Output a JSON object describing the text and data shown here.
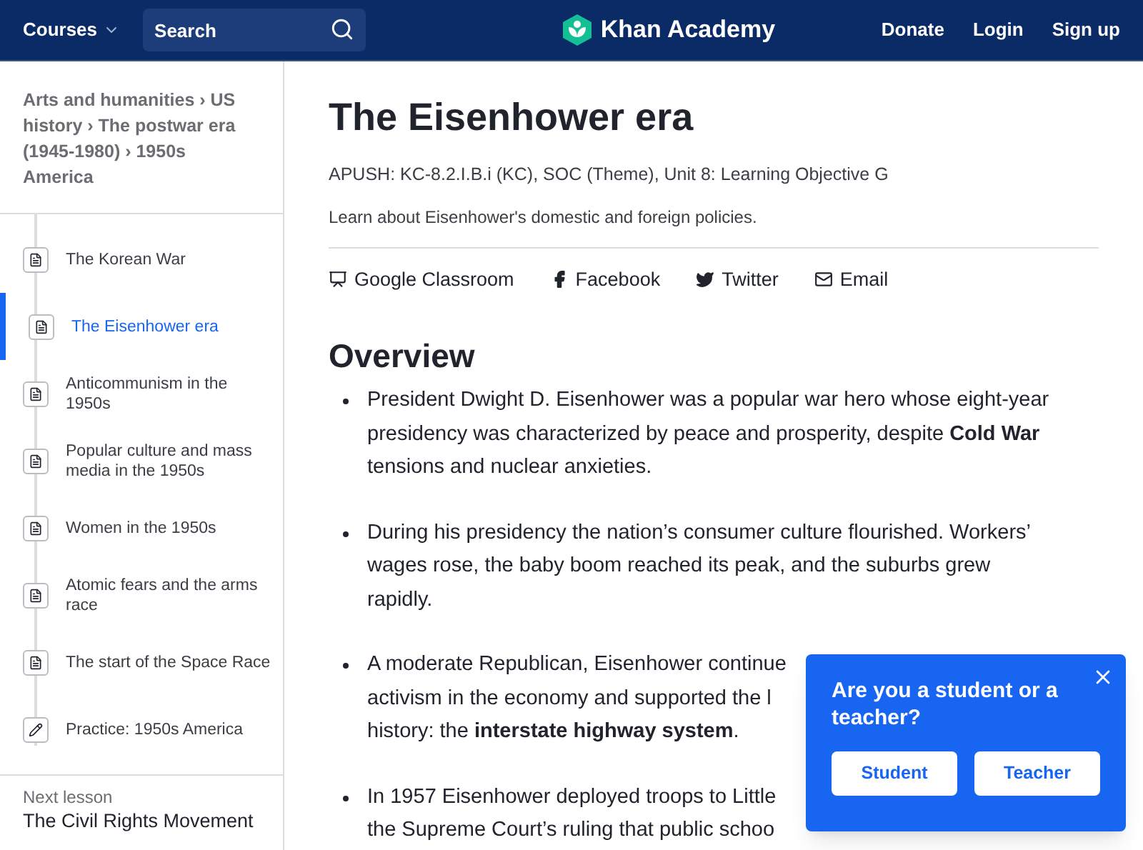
{
  "header": {
    "courses": "Courses",
    "search": {
      "placeholder": "Search"
    },
    "logo": "Khan Academy",
    "links": [
      "Donate",
      "Login",
      "Sign up"
    ]
  },
  "sidebar": {
    "breadcrumbs": "Arts and humanities › US history › The postwar era (1945-1980) › 1950s America",
    "items": [
      {
        "label": "The Korean War",
        "kind": "article",
        "selected": false
      },
      {
        "label": "The Eisenhower era",
        "kind": "article",
        "selected": true
      },
      {
        "label": "Anticommunism in the 1950s",
        "kind": "article",
        "selected": false
      },
      {
        "label": "Popular culture and mass media in the 1950s",
        "kind": "article",
        "selected": false
      },
      {
        "label": "Women in the 1950s",
        "kind": "article",
        "selected": false
      },
      {
        "label": "Atomic fears and the arms race",
        "kind": "article",
        "selected": false
      },
      {
        "label": "The start of the Space Race",
        "kind": "article",
        "selected": false
      },
      {
        "label": "Practice: 1950s America",
        "kind": "practice",
        "selected": false
      }
    ],
    "next_lesson": {
      "label": "Next lesson",
      "title": "The Civil Rights Movement"
    }
  },
  "article": {
    "title": "The Eisenhower era",
    "standards": "APUSH: KC-8.2.I.B.i (KC), SOC (Theme), Unit 8: Learning Objective G",
    "description": "Learn about Eisenhower's domestic and foreign policies.",
    "share": [
      {
        "kind": "classroom",
        "label": "Google Classroom"
      },
      {
        "kind": "facebook",
        "label": "Facebook"
      },
      {
        "kind": "twitter",
        "label": "Twitter"
      },
      {
        "kind": "email",
        "label": "Email"
      }
    ],
    "heading": "Overview",
    "bullets": [
      {
        "lines": [
          "President Dwight D. Eisenhower was a popular war hero whose eight-year",
          "presidency was characterized by peace and prosperity, despite **Cold War**",
          "tensions and nuclear anxieties."
        ]
      },
      {
        "lines": [
          "During his presidency the nation’s consumer culture flourished. Workers’",
          "wages rose, the baby boom reached its peak, and the suburbs grew",
          "rapidly."
        ]
      },
      {
        "lines": [
          "A moderate Republican, Eisenhower continue",
          "activism in the economy and supported the l",
          "history: the **interstate highway system**."
        ]
      },
      {
        "lines": [
          "In 1957 Eisenhower deployed troops to Little",
          "the Supreme Court’s ruling that public schoo"
        ]
      }
    ]
  },
  "popup": {
    "question": "Are you a student or a teacher?",
    "buttons": [
      "Student",
      "Teacher"
    ]
  }
}
